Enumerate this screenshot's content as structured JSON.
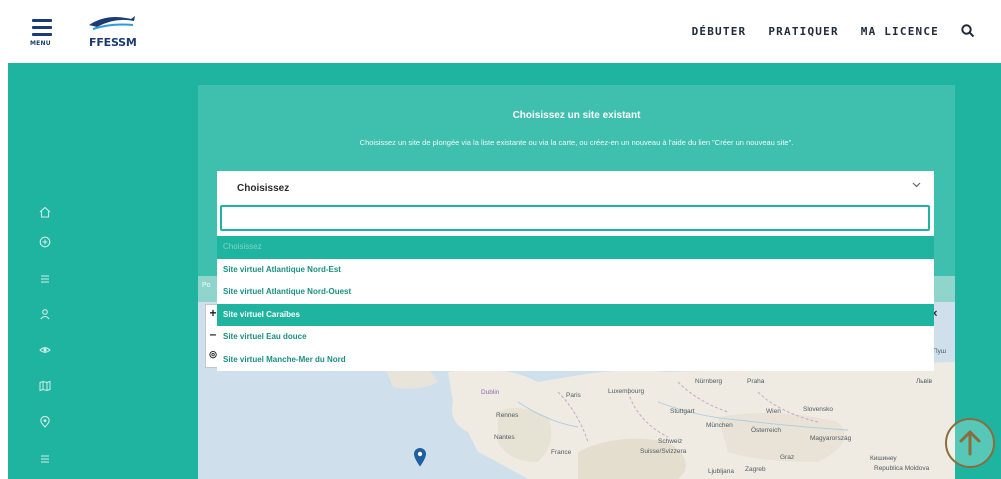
{
  "header": {
    "menu_label": "MENU",
    "logo_text": "FFESSM",
    "nav": [
      {
        "label": "DÉBUTER"
      },
      {
        "label": "PRATIQUER"
      },
      {
        "label": "MA LICENCE"
      }
    ]
  },
  "panel": {
    "title": "Choisissez un site existant",
    "subtitle": "Choisissez un site de plongée via la liste existante ou via la carte, ou créez-en un nouveau à l'aide du lien \"Créer un nouveau site\"."
  },
  "select": {
    "value": "Choisissez",
    "search_value": "",
    "options": [
      {
        "label": "Choisissez",
        "state": "placeholder"
      },
      {
        "label": "Site virtuel Atlantique Nord-Est",
        "state": "normal"
      },
      {
        "label": "Site virtuel Atlantique Nord-Ouest",
        "state": "normal"
      },
      {
        "label": "Site virtuel Caraïbes",
        "state": "selected"
      },
      {
        "label": "Site virtuel Eau douce",
        "state": "normal"
      },
      {
        "label": "Site virtuel Manche-Mer du Nord",
        "state": "normal"
      }
    ]
  },
  "map": {
    "strip_text": "Po",
    "zoom_in": "+",
    "zoom_out": "–",
    "close": "×",
    "labels": [
      "Dublin",
      "Paris",
      "Luxembourg",
      "Nürnberg",
      "Praha",
      "Rennes",
      "Stuttgart",
      "Wien",
      "München",
      "Nantes",
      "France",
      "Schweiz",
      "Suisse/Svizzera",
      "Magyarország",
      "Graz",
      "Zagreb",
      "Ljubljana",
      "Österreich",
      "Slovensko",
      "Пуш",
      "Львів",
      "Кишинеу",
      "Republica Moldova"
    ]
  },
  "colors": {
    "teal": "#1fb4a0",
    "panel": "#3fbfae",
    "navy": "#1d3b73"
  }
}
